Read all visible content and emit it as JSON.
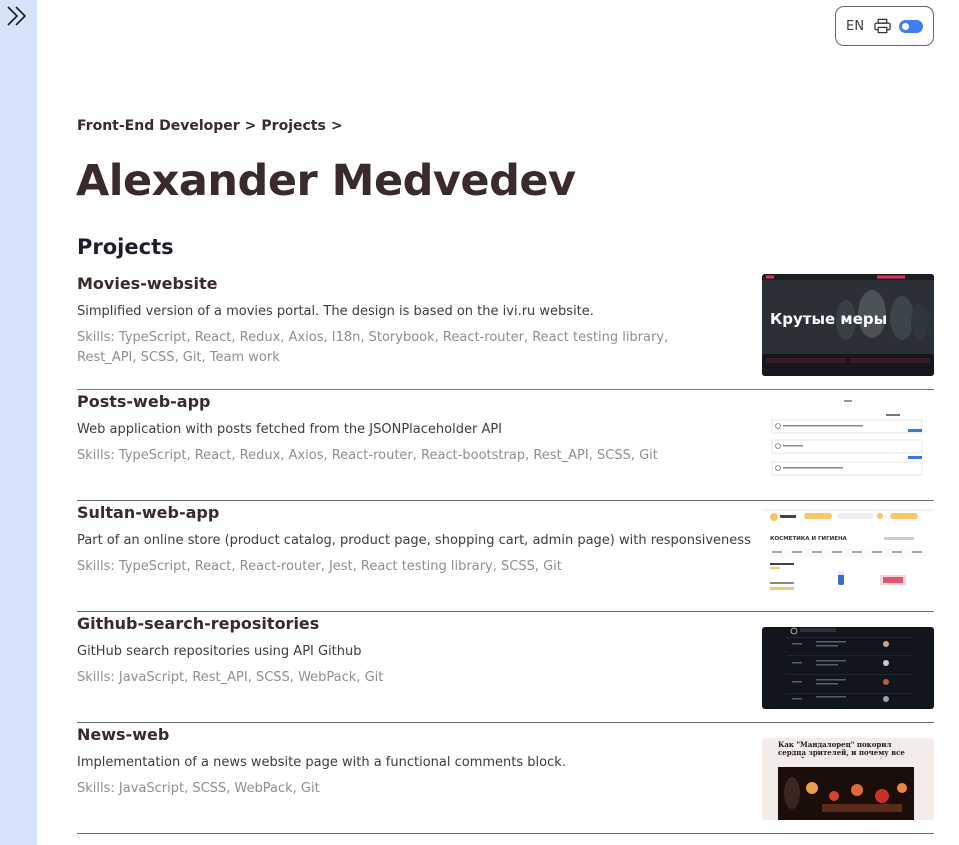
{
  "header": {
    "language": "EN",
    "print_icon": "printer-icon",
    "theme_toggle": "on"
  },
  "sidebar": {
    "toggle_icon": "chevrons-right-icon",
    "color": "#d6e4fb"
  },
  "breadcrumb": {
    "items": [
      "Front-End Developer",
      "Projects"
    ],
    "separator": ">"
  },
  "page_title": "Alexander Medvedev",
  "section_title": "Projects",
  "colors": {
    "accent": "#3f7ff0",
    "title": "#3b2a2a",
    "skills": "#8f8f8f"
  },
  "projects": [
    {
      "name": "Movies-website",
      "description": "Simplified version of a movies portal. The design is based on the ivi.ru website.",
      "skills": "Skills: TypeScript, React, Redux, Axios, I18n, Storybook, React-router, React testing library, Rest_API, SCSS, Git, Team work",
      "thumb_text": "Крутые меры"
    },
    {
      "name": "Posts-web-app",
      "description": "Web application with posts fetched from the JSONPlaceholder API",
      "skills": "Skills: TypeScript, React, Redux, Axios, React-router, React-bootstrap, Rest_API, SCSS, Git"
    },
    {
      "name": "Sultan-web-app",
      "description": "Part of an online store (product catalog, product page, shopping cart, admin page) with responsiveness",
      "skills": "Skills: TypeScript, React, React-router, Jest, React testing library, SCSS, Git",
      "thumb_text": "КОСМЕТИКА И ГИГИЕНА"
    },
    {
      "name": "Github-search-repositories",
      "description": "GitHub search repositories using API Github",
      "skills": "Skills: JavaScript, Rest_API, SCSS, WebPack, Git"
    },
    {
      "name": "News-web",
      "description": "Implementation of a news website page with a functional comments block.",
      "skills": "Skills: JavaScript, SCSS, WebPack, Git",
      "thumb_text": "Как \"Мандалорец\" покорил сердца зрителей, и почему все полюбили"
    }
  ]
}
